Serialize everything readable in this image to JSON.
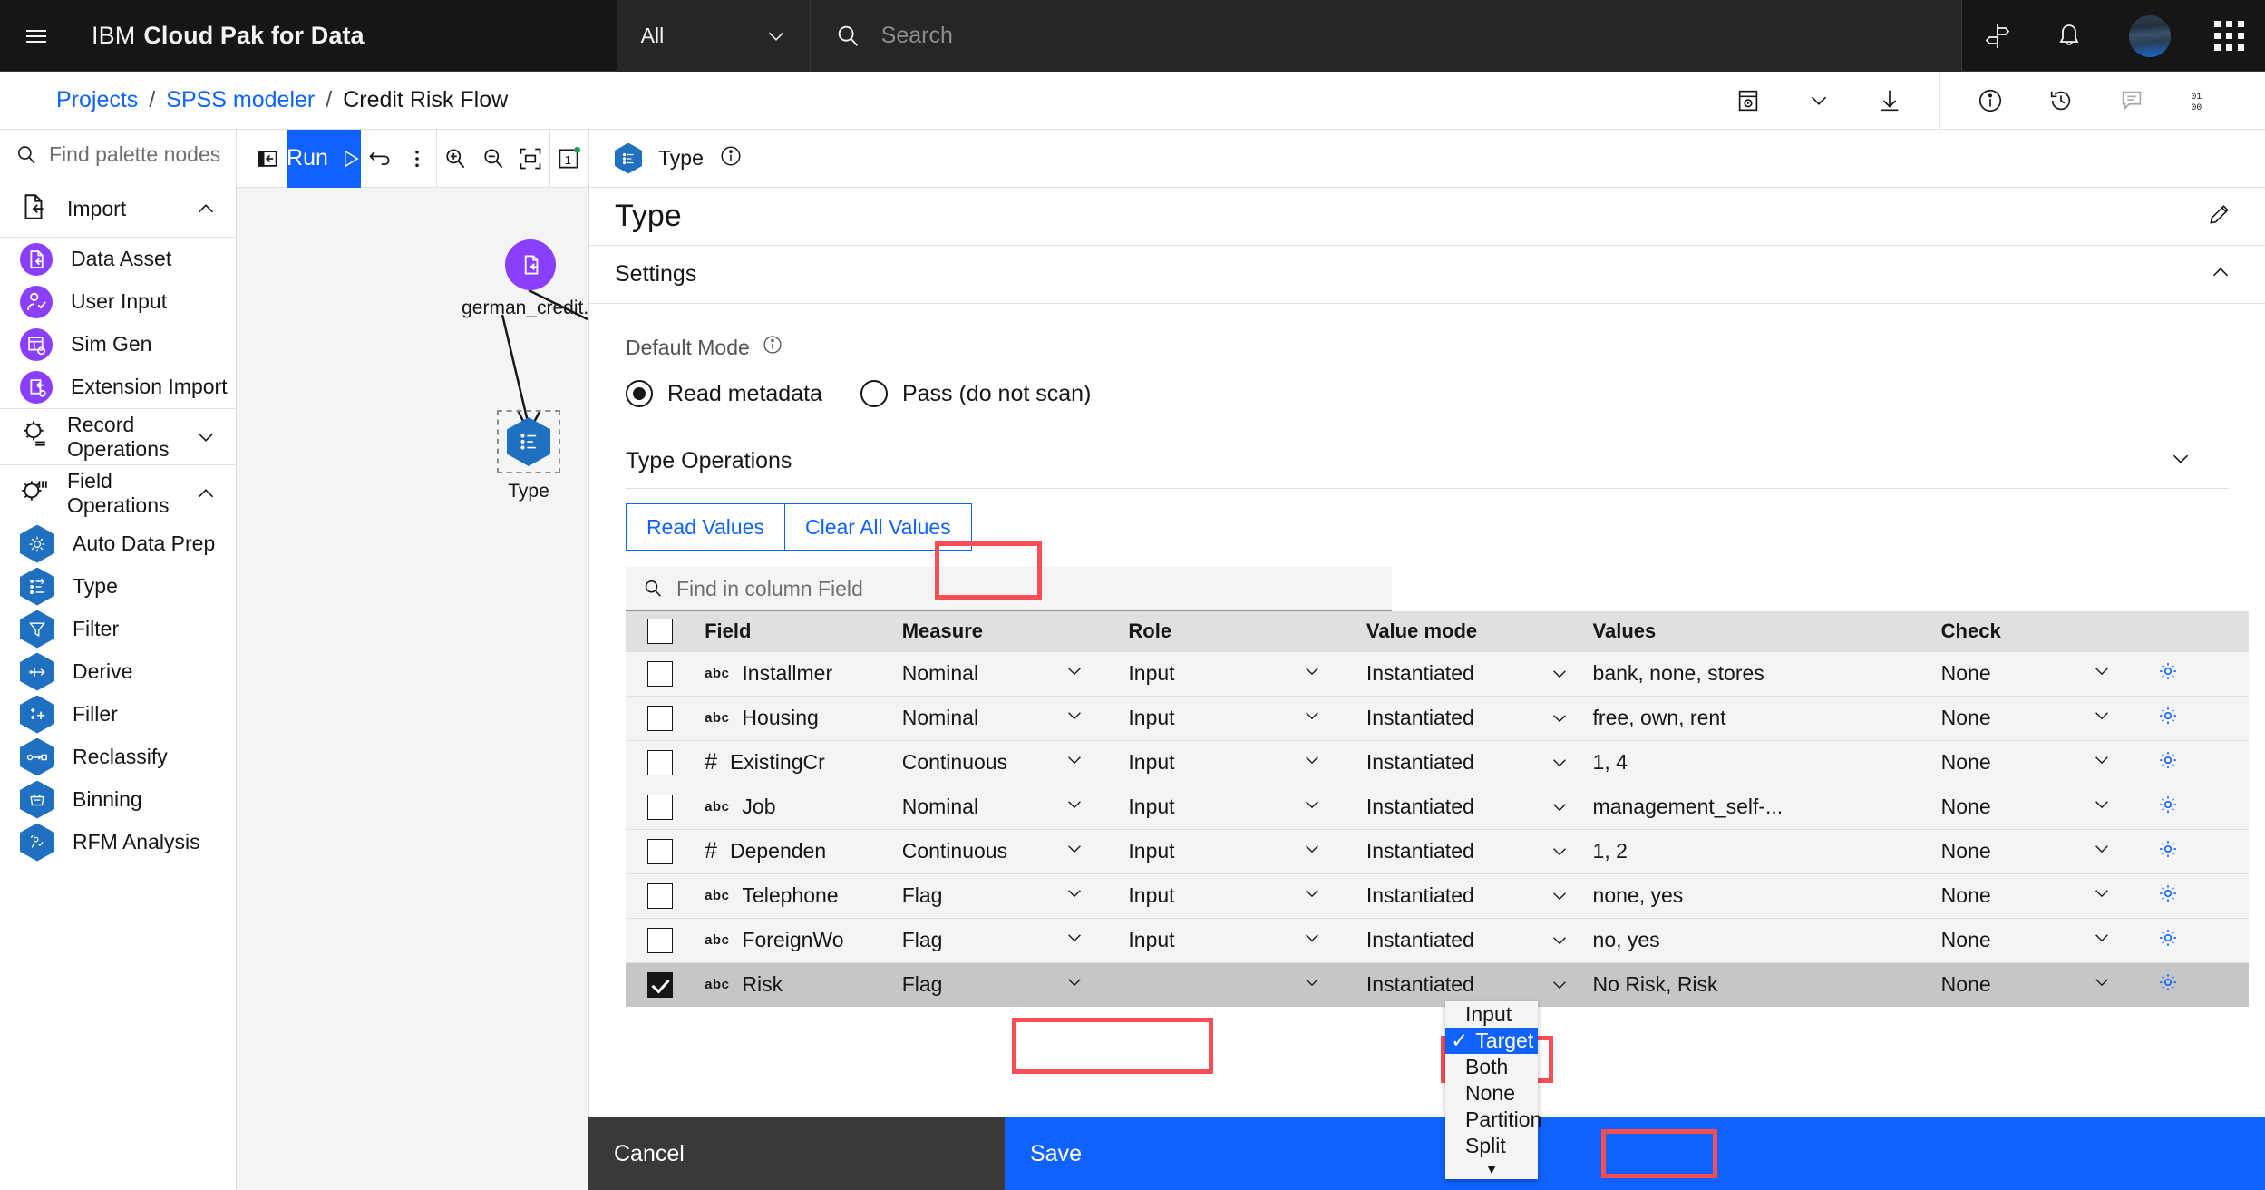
{
  "header": {
    "menu_icon": "hamburger-menu-icon",
    "brand_prefix": "IBM",
    "brand_name": "Cloud Pak for Data",
    "scope_select": "All",
    "search_placeholder": "Search",
    "icons": [
      "signpost-icon",
      "notification-bell-icon",
      "avatar",
      "app-switcher-icon"
    ]
  },
  "breadcrumb": {
    "projects": "Projects",
    "sep": "/",
    "spss": "SPSS modeler",
    "current": "Credit Risk Flow"
  },
  "palette": {
    "search_placeholder": "Find palette nodes",
    "groups": [
      {
        "label": "Import",
        "icon": "import-icon",
        "expanded": true,
        "items": [
          {
            "label": "Data Asset",
            "icon": "data-asset-icon"
          },
          {
            "label": "User Input",
            "icon": "user-input-icon"
          },
          {
            "label": "Sim Gen",
            "icon": "sim-gen-icon"
          },
          {
            "label": "Extension Import",
            "icon": "extension-import-icon"
          }
        ]
      },
      {
        "label": "Record Operations",
        "icon": "record-operations-icon",
        "expanded": false,
        "items": []
      },
      {
        "label": "Field Operations",
        "icon": "field-operations-icon",
        "expanded": true,
        "items": [
          {
            "label": "Auto Data Prep",
            "icon": "auto-data-prep-icon"
          },
          {
            "label": "Type",
            "icon": "type-icon"
          },
          {
            "label": "Filter",
            "icon": "filter-icon"
          },
          {
            "label": "Derive",
            "icon": "derive-icon"
          },
          {
            "label": "Filler",
            "icon": "filler-icon"
          },
          {
            "label": "Reclassify",
            "icon": "reclassify-icon"
          },
          {
            "label": "Binning",
            "icon": "binning-icon"
          },
          {
            "label": "RFM Analysis",
            "icon": "rfm-analysis-icon"
          }
        ]
      }
    ]
  },
  "canvas_toolbar": {
    "collapse_label": "collapse-palette-icon",
    "run_label": "Run",
    "undo_label": "undo-icon",
    "overflow_label": "overflow-menu-icon",
    "zoom_in": "zoom-in-icon",
    "zoom_out": "zoom-out-icon",
    "fit": "zoom-fit-icon",
    "pages": "1"
  },
  "canvas": {
    "nodes": [
      {
        "label": "german_credit...",
        "icon": "data-asset-node-icon"
      },
      {
        "label": "Type",
        "icon": "type-node-icon"
      }
    ]
  },
  "panel": {
    "node_kind": "Type",
    "info_icon": "information-icon",
    "title": "Type",
    "edit_icon": "edit-pencil-icon",
    "section_title": "Settings",
    "default_mode_label": "Default Mode",
    "radio_read": "Read metadata",
    "radio_pass": "Pass (do not scan)",
    "radio_selected": "Read metadata",
    "type_operations_label": "Type Operations",
    "read_values_btn": "Read Values",
    "clear_values_btn": "Clear All Values",
    "table_search_placeholder": "Find in column Field"
  },
  "table": {
    "columns": [
      "Field",
      "Measure",
      "Role",
      "Value mode",
      "Values",
      "Check"
    ],
    "rows": [
      {
        "checked": false,
        "type": "abc",
        "field": "Installmer",
        "measure": "Nominal",
        "role": "Input",
        "value_mode": "Instantiated",
        "values": "bank, none, stores",
        "check": "None"
      },
      {
        "checked": false,
        "type": "abc",
        "field": "Housing",
        "measure": "Nominal",
        "role": "Input",
        "value_mode": "Instantiated",
        "values": "free, own, rent",
        "check": "None"
      },
      {
        "checked": false,
        "type": "#",
        "field": "ExistingCr",
        "measure": "Continuous",
        "role": "Input",
        "value_mode": "Instantiated",
        "values": "1, 4",
        "check": "None"
      },
      {
        "checked": false,
        "type": "abc",
        "field": "Job",
        "measure": "Nominal",
        "role": "Input",
        "value_mode": "Instantiated",
        "values": "management_self-...",
        "check": "None"
      },
      {
        "checked": false,
        "type": "#",
        "field": "Dependen",
        "measure": "Continuous",
        "role": "Input",
        "value_mode": "Instantiated",
        "values": "1, 2",
        "check": "None"
      },
      {
        "checked": false,
        "type": "abc",
        "field": "Telephone",
        "measure": "Flag",
        "role": "Input",
        "value_mode": "Instantiated",
        "values": "none, yes",
        "check": "None"
      },
      {
        "checked": false,
        "type": "abc",
        "field": "ForeignWo",
        "measure": "Flag",
        "role": "Input",
        "value_mode": "Instantiated",
        "values": "no, yes",
        "check": "None"
      },
      {
        "checked": true,
        "type": "abc",
        "field": "Risk",
        "measure": "Flag",
        "role": "",
        "value_mode": "Instantiated",
        "values": "No Risk, Risk",
        "check": "None"
      }
    ]
  },
  "role_dropdown": {
    "options": [
      "Input",
      "Target",
      "Both",
      "None",
      "Partition",
      "Split"
    ],
    "selected": "Target",
    "more_icon": "scroll-down-arrow-icon"
  },
  "footer": {
    "cancel_label": "Cancel",
    "save_label": "Save"
  },
  "colors": {
    "accent_blue": "#0f62fe",
    "highlight_red": "#fa4d56",
    "header_black": "#161616",
    "purple_node": "#8a3ffc",
    "blue_node": "#1f70c1"
  }
}
